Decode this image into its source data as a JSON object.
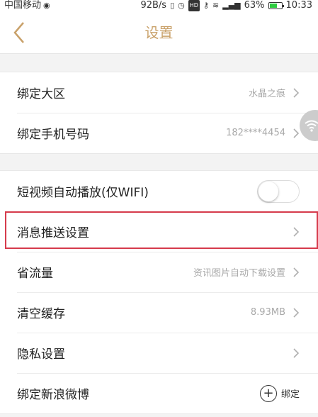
{
  "status_bar": {
    "carrier": "中国移动",
    "speed": "92B/s",
    "hd": "HD",
    "battery": "63%",
    "battery_level": 0.63,
    "time": "10:33"
  },
  "nav": {
    "title": "设置",
    "back_icon": "chevron-left-icon"
  },
  "groups": {
    "account": {
      "items": [
        {
          "label": "绑定大区",
          "value": "水晶之痕"
        },
        {
          "label": "绑定手机号码",
          "value": "182****4454"
        }
      ]
    },
    "settings": {
      "autoplay": {
        "label": "短视频自动播放(仅WIFI)",
        "enabled": false
      },
      "items": [
        {
          "label": "消息推送设置",
          "value": ""
        },
        {
          "label": "省流量",
          "value": "资讯图片自动下载设置"
        },
        {
          "label": "清空缓存",
          "value": "8.93MB"
        },
        {
          "label": "隐私设置",
          "value": ""
        }
      ],
      "weibo": {
        "label": "绑定新浪微博",
        "action": "绑定"
      }
    }
  },
  "colors": {
    "accent": "#c9a16a",
    "highlight": "#d63b4c",
    "value_text": "#a9a9a9"
  },
  "icons": {
    "chevron": "chevron-right-icon",
    "float": "wifi-icon",
    "plus": "plus-circle-icon"
  }
}
